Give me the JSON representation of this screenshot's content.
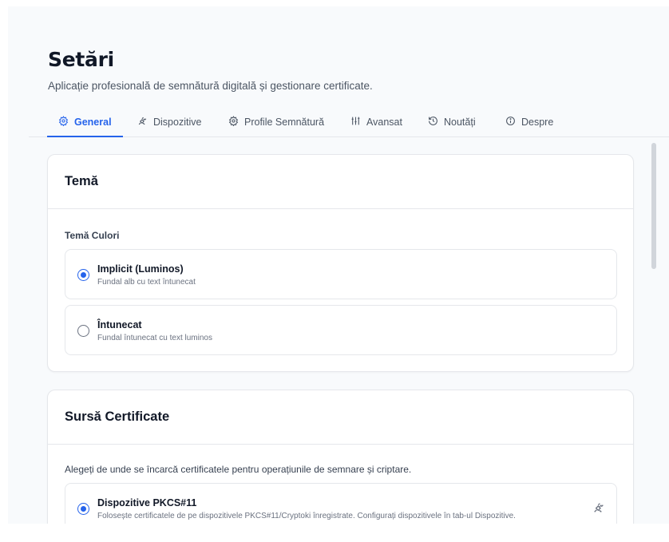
{
  "page": {
    "title": "Setări",
    "subtitle": "Aplicație profesională de semnătură digitală și gestionare certificate."
  },
  "tabs": [
    {
      "label": "General",
      "icon": "gear-icon",
      "active": true
    },
    {
      "label": "Dispozitive",
      "icon": "plug-icon",
      "active": false
    },
    {
      "label": "Profile Semnătură",
      "icon": "gear-icon",
      "active": false
    },
    {
      "label": "Avansat",
      "icon": "sliders-icon",
      "active": false
    },
    {
      "label": "Noutăți",
      "icon": "history-icon",
      "active": false
    },
    {
      "label": "Despre",
      "icon": "info-icon",
      "active": false
    }
  ],
  "theme_card": {
    "title": "Temă",
    "field_label": "Temă Culori",
    "options": [
      {
        "title": "Implicit (Luminos)",
        "description": "Fundal alb cu text întunecat",
        "checked": true
      },
      {
        "title": "Întunecat",
        "description": "Fundal întunecat cu text luminos",
        "checked": false
      }
    ]
  },
  "cert_card": {
    "title": "Sursă Certificate",
    "description": "Alegeți de unde se încarcă certificatele pentru operațiunile de semnare și criptare.",
    "options": [
      {
        "title": "Dispozitive PKCS#11",
        "description": "Folosește certificatele de pe dispozitivele PKCS#11/Cryptoki înregistrate. Configurați dispozitivele în tab-ul Dispozitive.",
        "checked": true,
        "icon": "plug-icon"
      }
    ]
  },
  "colors": {
    "accent": "#2563eb",
    "background": "#f8fafc",
    "border": "#e5e7eb"
  }
}
